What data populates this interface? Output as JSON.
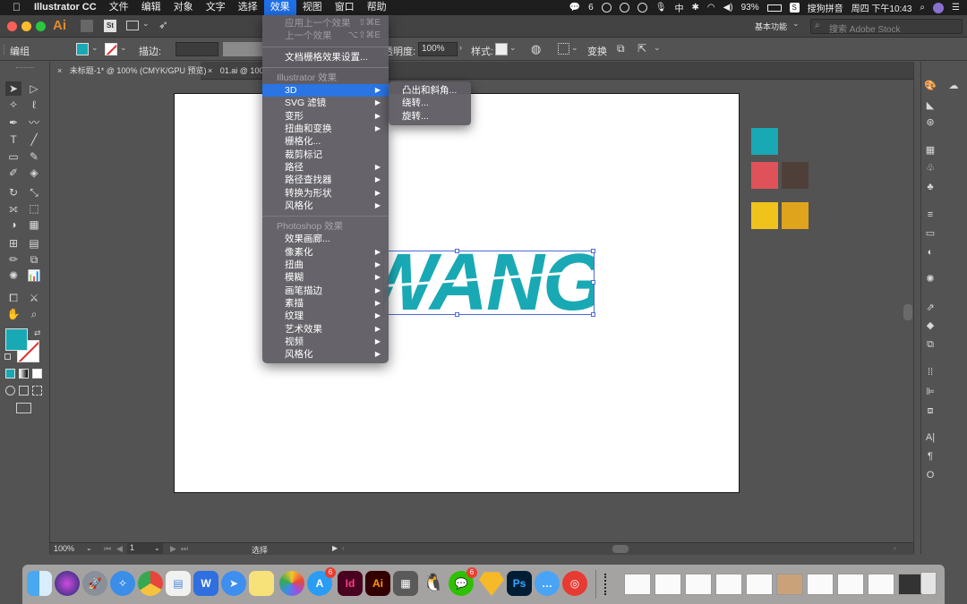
{
  "menubar": {
    "apple": "",
    "app_name": "Illustrator CC",
    "items": [
      "文件",
      "编辑",
      "对象",
      "文字",
      "选择",
      "效果",
      "视图",
      "窗口",
      "帮助"
    ],
    "active_index": 5,
    "status": {
      "wechat_count": "6",
      "battery": "93%",
      "input_method": "搜狗拼音",
      "datetime": "周四 下午10:43"
    }
  },
  "appbar": {
    "app_logo": "Ai",
    "stock_logo": "St",
    "workspace": "基本功能",
    "search_placeholder": "搜索 Adobe Stock"
  },
  "controlbar": {
    "mode_label": "编组",
    "stroke_label": "描边:",
    "opacity_label": "透明度:",
    "opacity_value": "100%",
    "style_label": "样式:",
    "transform_label": "变换",
    "fill_color": "#19a9b4"
  },
  "tabs": [
    {
      "label": "未标题-1* @ 100% (CMYK/GPU 预览)",
      "close": "×"
    },
    {
      "label": "01.ai @ 100%",
      "close": "×"
    }
  ],
  "effect_menu": {
    "items": [
      {
        "label": "应用上一个效果",
        "shortcut": "⇧⌘E",
        "disabled": true
      },
      {
        "label": "上一个效果",
        "shortcut": "⌥⇧⌘E",
        "disabled": true
      },
      {
        "label": "文档栅格效果设置..."
      },
      {
        "label": "Illustrator 效果",
        "header": true
      },
      {
        "label": "3D",
        "submenu": true,
        "highlight": true
      },
      {
        "label": "SVG 滤镜",
        "submenu": true
      },
      {
        "label": "变形",
        "submenu": true
      },
      {
        "label": "扭曲和变换",
        "submenu": true
      },
      {
        "label": "栅格化..."
      },
      {
        "label": "裁剪标记"
      },
      {
        "label": "路径",
        "submenu": true
      },
      {
        "label": "路径查找器",
        "submenu": true
      },
      {
        "label": "转换为形状",
        "submenu": true
      },
      {
        "label": "风格化",
        "submenu": true
      },
      {
        "label": "Photoshop 效果",
        "header": true
      },
      {
        "label": "效果画廊..."
      },
      {
        "label": "像素化",
        "submenu": true
      },
      {
        "label": "扭曲",
        "submenu": true
      },
      {
        "label": "模糊",
        "submenu": true
      },
      {
        "label": "画笔描边",
        "submenu": true
      },
      {
        "label": "素描",
        "submenu": true
      },
      {
        "label": "纹理",
        "submenu": true
      },
      {
        "label": "艺术效果",
        "submenu": true
      },
      {
        "label": "视频",
        "submenu": true
      },
      {
        "label": "风格化",
        "submenu": true
      }
    ],
    "submenu_3d": [
      "凸出和斜角...",
      "绕转...",
      "旋转..."
    ]
  },
  "artboard": {
    "text": "WANG",
    "text_color": "#19a9b4",
    "swatches": [
      "#19a9b4",
      "#e0525a",
      "#4f3f39",
      "#f0c21c",
      "#e0a41c"
    ]
  },
  "statusbar": {
    "zoom": "100%",
    "page": "1",
    "mode": "选择"
  },
  "dock": {
    "apps": [
      "Finder",
      "Siri",
      "Launchpad",
      "Safari",
      "Chrome",
      "Preview",
      "WPS",
      "Mail",
      "Notes",
      "Photos",
      "App Store",
      "InDesign",
      "Illustrator",
      "Calculator",
      "QQ",
      "WeChat",
      "Sketch",
      "Photoshop",
      "Messages",
      "NetEase Music"
    ],
    "badges": {
      "app_store": "6",
      "wechat": "6"
    }
  }
}
